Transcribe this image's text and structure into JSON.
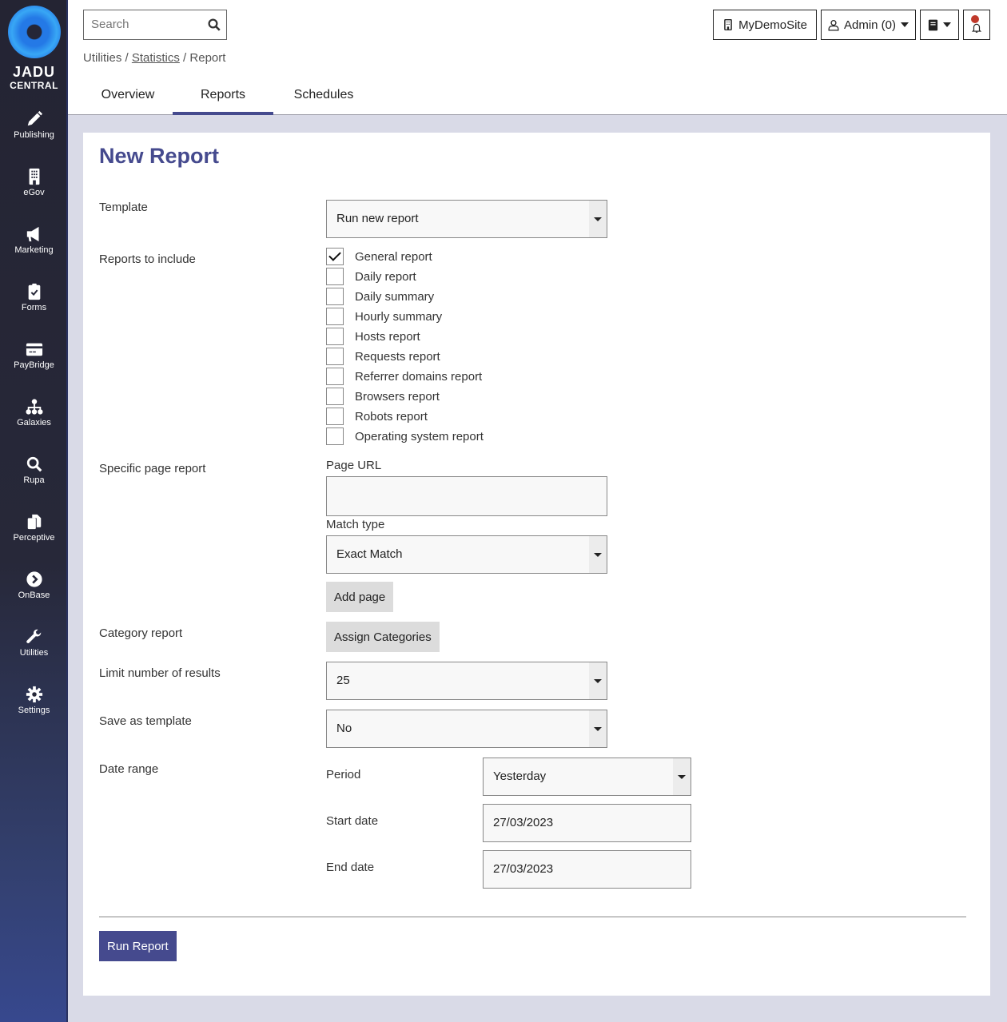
{
  "brand": {
    "line1": "JADU",
    "line2": "CENTRAL"
  },
  "sidebar": {
    "items": [
      {
        "label": "Publishing",
        "icon": "pencil-icon"
      },
      {
        "label": "eGov",
        "icon": "building-icon"
      },
      {
        "label": "Marketing",
        "icon": "megaphone-icon"
      },
      {
        "label": "Forms",
        "icon": "clipboard-check-icon"
      },
      {
        "label": "PayBridge",
        "icon": "credit-card-icon"
      },
      {
        "label": "Galaxies",
        "icon": "sitemap-icon"
      },
      {
        "label": "Rupa",
        "icon": "search-icon"
      },
      {
        "label": "Perceptive",
        "icon": "copy-icon"
      },
      {
        "label": "OnBase",
        "icon": "chevron-circle-icon"
      },
      {
        "label": "Utilities",
        "icon": "wrench-icon"
      },
      {
        "label": "Settings",
        "icon": "gear-icon"
      }
    ]
  },
  "header": {
    "search_placeholder": "Search",
    "breadcrumb": {
      "part1": "Utilities",
      "sep": " / ",
      "part2": "Statistics",
      "part3": "Report"
    },
    "tabs": [
      {
        "label": "Overview"
      },
      {
        "label": "Reports",
        "active": true
      },
      {
        "label": "Schedules"
      }
    ],
    "site_label": "MyDemoSite",
    "user_label": "Admin (0)"
  },
  "form": {
    "title": "New Report",
    "template_label": "Template",
    "template_value": "Run new report",
    "reports_label": "Reports to include",
    "reports": [
      {
        "label": "General report",
        "checked": true
      },
      {
        "label": "Daily report",
        "checked": false
      },
      {
        "label": "Daily summary",
        "checked": false
      },
      {
        "label": "Hourly summary",
        "checked": false
      },
      {
        "label": "Hosts report",
        "checked": false
      },
      {
        "label": "Requests report",
        "checked": false
      },
      {
        "label": "Referrer domains report",
        "checked": false
      },
      {
        "label": "Browsers report",
        "checked": false
      },
      {
        "label": "Robots report",
        "checked": false
      },
      {
        "label": "Operating system report",
        "checked": false
      }
    ],
    "specific_page_label": "Specific page report",
    "page_url_label": "Page URL",
    "page_url_value": "",
    "match_type_label": "Match type",
    "match_type_value": "Exact Match",
    "add_page_label": "Add page",
    "category_label": "Category report",
    "assign_categories_label": "Assign Categories",
    "limit_label": "Limit number of results",
    "limit_value": "25",
    "save_template_label": "Save as template",
    "save_template_value": "No",
    "date_range_label": "Date range",
    "period_label": "Period",
    "period_value": "Yesterday",
    "start_date_label": "Start date",
    "start_date_value": "27/03/2023",
    "end_date_label": "End date",
    "end_date_value": "27/03/2023",
    "run_label": "Run Report"
  },
  "colors": {
    "accent": "#454a8e",
    "notification": "#c0392b"
  }
}
